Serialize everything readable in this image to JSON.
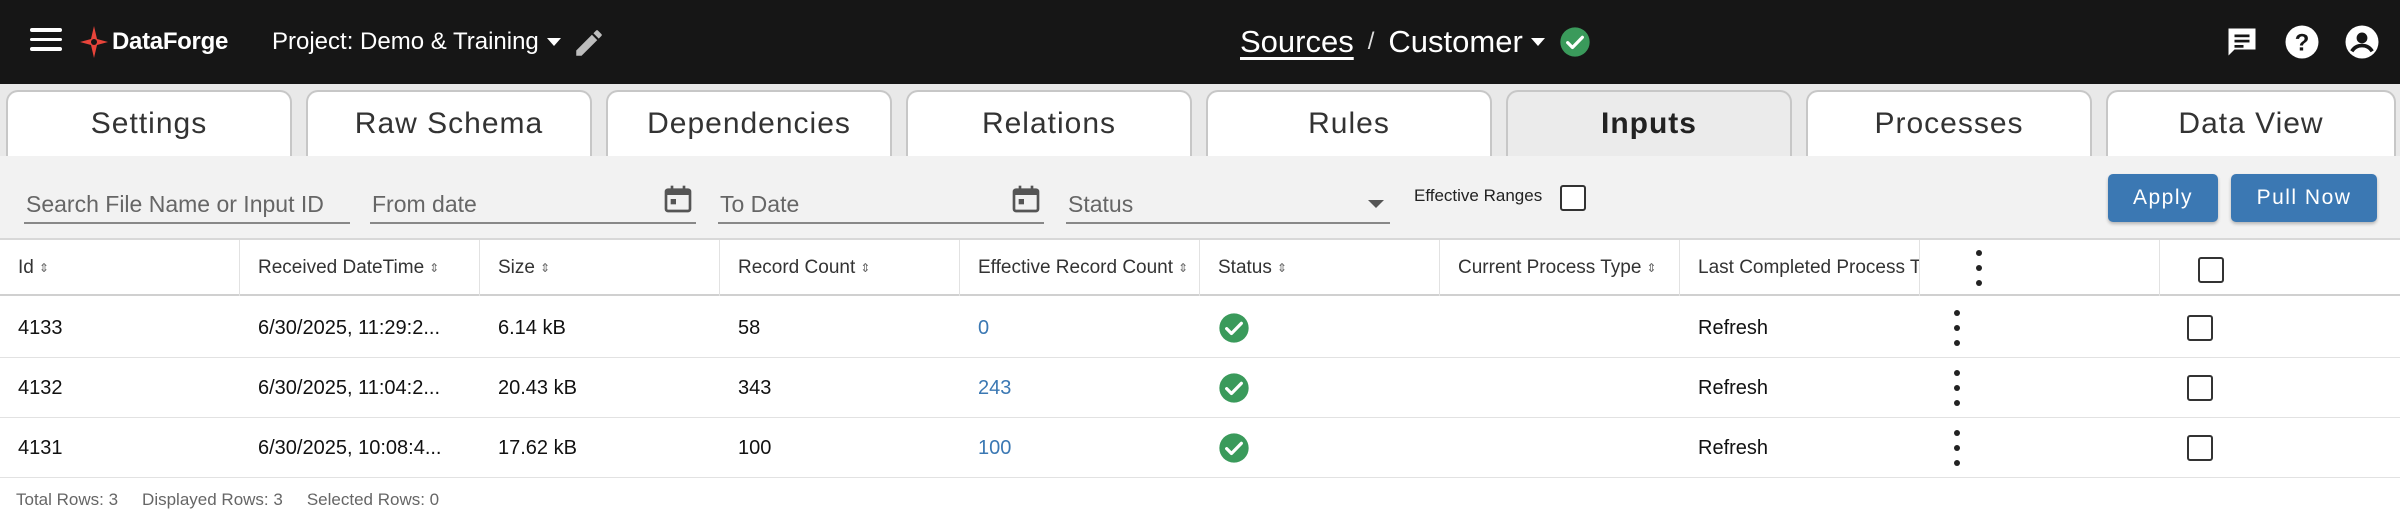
{
  "app": {
    "brand": "DataForge",
    "accent": "#3b78b3",
    "success": "#2e8b57"
  },
  "header": {
    "project_label": "Project: Demo & Training",
    "breadcrumb_root": "Sources",
    "breadcrumb_sep": "/",
    "breadcrumb_current": "Customer"
  },
  "tabs": [
    {
      "label": "Settings"
    },
    {
      "label": "Raw Schema"
    },
    {
      "label": "Dependencies"
    },
    {
      "label": "Relations"
    },
    {
      "label": "Rules"
    },
    {
      "label": "Inputs",
      "active": true
    },
    {
      "label": "Processes"
    },
    {
      "label": "Data View"
    }
  ],
  "filters": {
    "search_placeholder": "Search File Name or Input ID",
    "from_placeholder": "From date",
    "to_placeholder": "To Date",
    "status_placeholder": "Status",
    "effective_ranges_label": "Effective Ranges",
    "apply_label": "Apply",
    "pull_now_label": "Pull Now"
  },
  "table": {
    "columns": [
      "Id",
      "Received DateTime",
      "Size",
      "Record Count",
      "Effective Record Count",
      "Status",
      "Current Process Type",
      "Last Completed Process Type"
    ],
    "rows": [
      {
        "id": "4133",
        "received": "6/30/2025, 11:29:2...",
        "size": "6.14 kB",
        "records": "58",
        "effective": "0",
        "status": "success",
        "current_process": "",
        "last_process": "Refresh"
      },
      {
        "id": "4132",
        "received": "6/30/2025, 11:04:2...",
        "size": "20.43 kB",
        "records": "343",
        "effective": "243",
        "status": "success",
        "current_process": "",
        "last_process": "Refresh"
      },
      {
        "id": "4131",
        "received": "6/30/2025, 10:08:4...",
        "size": "17.62 kB",
        "records": "100",
        "effective": "100",
        "status": "success",
        "current_process": "",
        "last_process": "Refresh"
      }
    ]
  },
  "footer": {
    "total": "Total Rows: 3",
    "displayed": "Displayed Rows: 3",
    "selected": "Selected Rows: 0"
  }
}
